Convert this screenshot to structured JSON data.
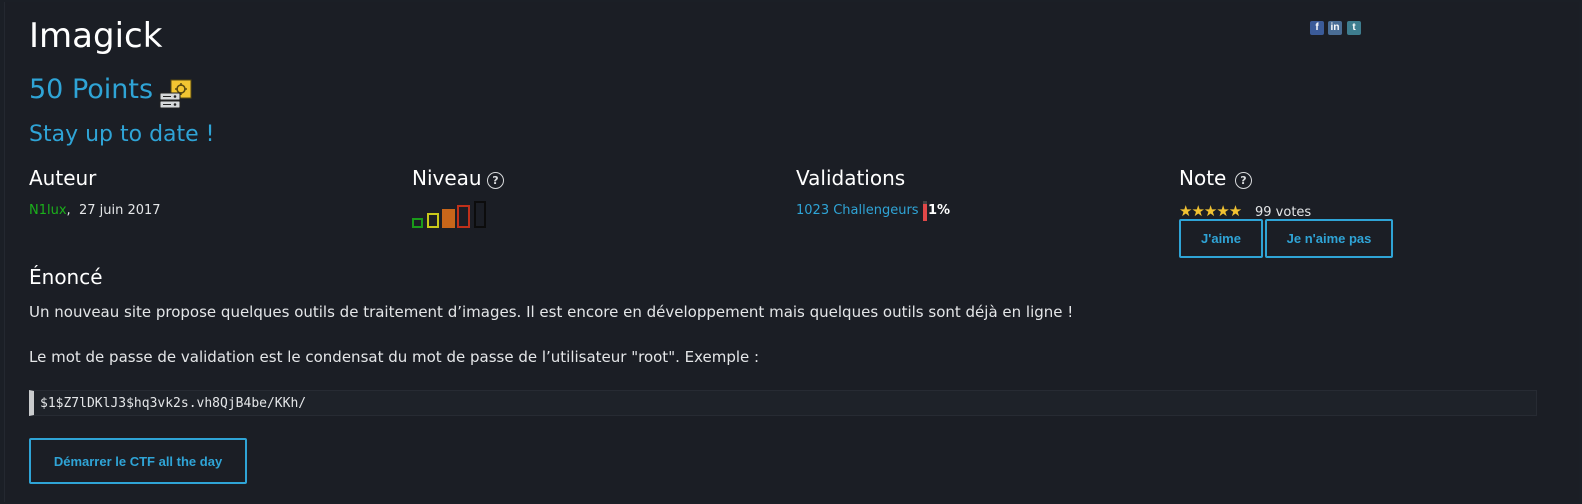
{
  "challenge": {
    "title": "Imagick",
    "points": "50 Points",
    "subtitle": "Stay up to date !"
  },
  "social": {
    "facebook": "f",
    "linkedin": "in",
    "other": "t"
  },
  "author": {
    "heading": "Auteur",
    "name": "N1lux",
    "separator": ",",
    "date": "27 juin 2017"
  },
  "level": {
    "heading": "Niveau",
    "help": "?",
    "current_level": 3,
    "max_level": 5,
    "colors": [
      "#1a9a1a",
      "#c8c81a",
      "#c8661a",
      "#c0301a",
      "#0c0c0c"
    ]
  },
  "validations": {
    "heading": "Validations",
    "challengers": "1023 Challengeurs",
    "percent_label": "1%",
    "percent": 1,
    "bar_color": "#e04848"
  },
  "rating": {
    "heading": "Note",
    "help": "?",
    "stars": "★★★★★",
    "star_count": 5,
    "votes": "99 votes",
    "like_button": "J'aime",
    "dislike_button": "Je n'aime pas"
  },
  "statement": {
    "heading": "Énoncé",
    "paragraph1": "Un nouveau site propose quelques outils de traitement d’images. Il est encore en développement mais quelques outils sont déjà en ligne !",
    "paragraph2": "Le mot de passe de validation est le condensat du mot de passe de l’utilisateur \"root\". Exemple :",
    "example_hash": "$1$Z7lDKlJ3$hq3vk2s.vh8QjB4be/KKh/"
  },
  "start_button": "Démarrer le CTF all the day",
  "colors": {
    "accent": "#2fa4d6",
    "background": "#1b1e25",
    "author_link": "#1bb01b"
  },
  "icons": {
    "category": "server-network-icon",
    "help": "question-circle-icon"
  }
}
